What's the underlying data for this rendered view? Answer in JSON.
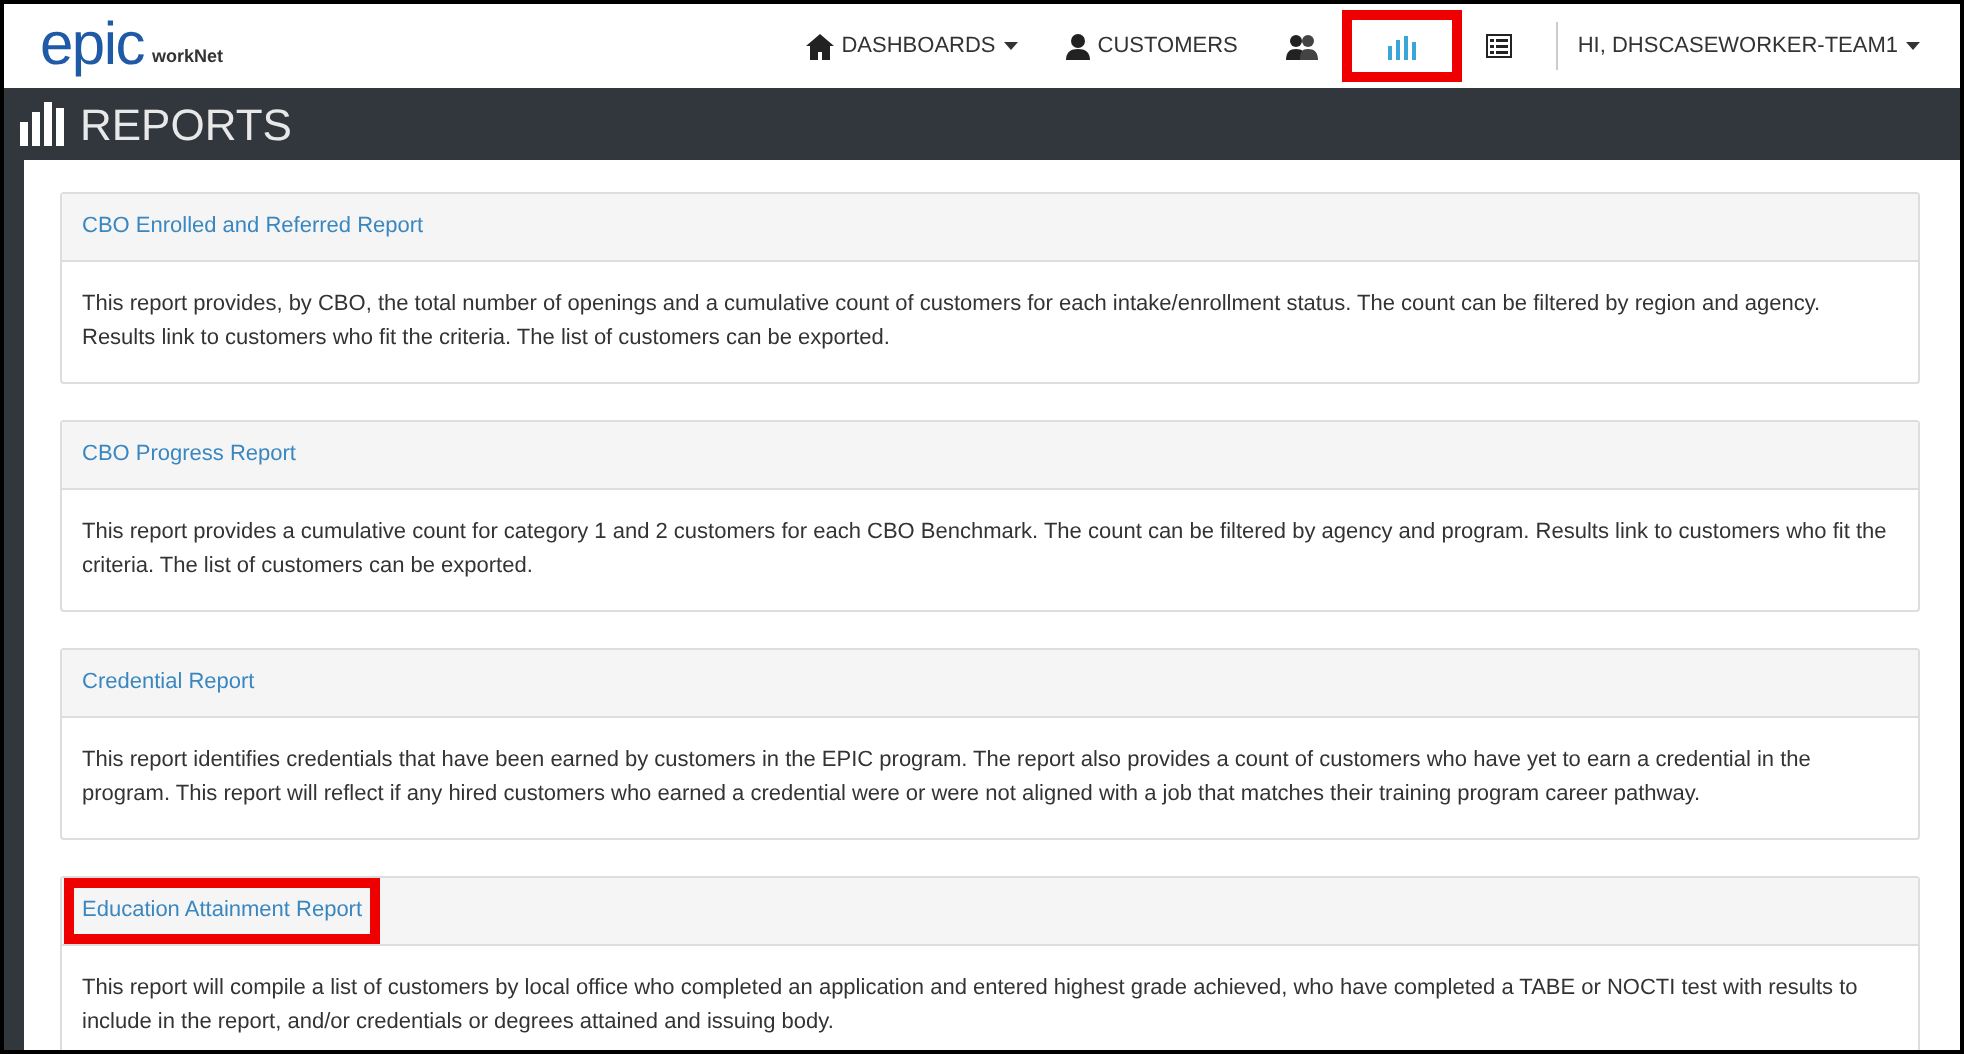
{
  "logo": {
    "brand": "epic",
    "partner": "workNet"
  },
  "nav": [
    {
      "kind": "home",
      "label": "DASHBOARDS",
      "dropdown": true,
      "highlighted": false
    },
    {
      "kind": "user",
      "label": "CUSTOMERS",
      "dropdown": false,
      "highlighted": false
    },
    {
      "kind": "users",
      "dropdown": false,
      "highlighted": false
    },
    {
      "kind": "chart",
      "dropdown": false,
      "highlighted": true
    },
    {
      "kind": "list",
      "dropdown": false,
      "highlighted": false
    }
  ],
  "user_menu": {
    "label": "HI, DHSCASEWORKER-TEAM1"
  },
  "page_title": "REPORTS",
  "reports": [
    {
      "title": "CBO Enrolled and Referred Report",
      "description": "This report provides, by CBO, the total number of openings and a cumulative count of customers for each intake/enrollment status. The count can be filtered by region and agency. Results link to customers who fit the criteria. The list of customers can be exported.",
      "highlighted": false
    },
    {
      "title": "CBO Progress Report",
      "description": "This report provides a cumulative count for category 1 and 2 customers for each CBO Benchmark. The count can be filtered by agency and program. Results link to customers who fit the criteria. The list of customers can be exported.",
      "highlighted": false
    },
    {
      "title": "Credential Report",
      "description": "This report identifies credentials that have been earned by customers in the EPIC program. The report also provides a count of customers who have yet to earn a credential in the program. This report will reflect if any hired customers who earned a credential were or were not aligned with a job that matches their training program career pathway.",
      "highlighted": false
    },
    {
      "title": "Education Attainment Report",
      "description": "This report will compile a list of customers by local office who completed an application and entered highest grade achieved, who have completed a TABE or NOCTI test with results to include in the report, and/or credentials or degrees attained and issuing body.",
      "highlighted": true
    }
  ]
}
